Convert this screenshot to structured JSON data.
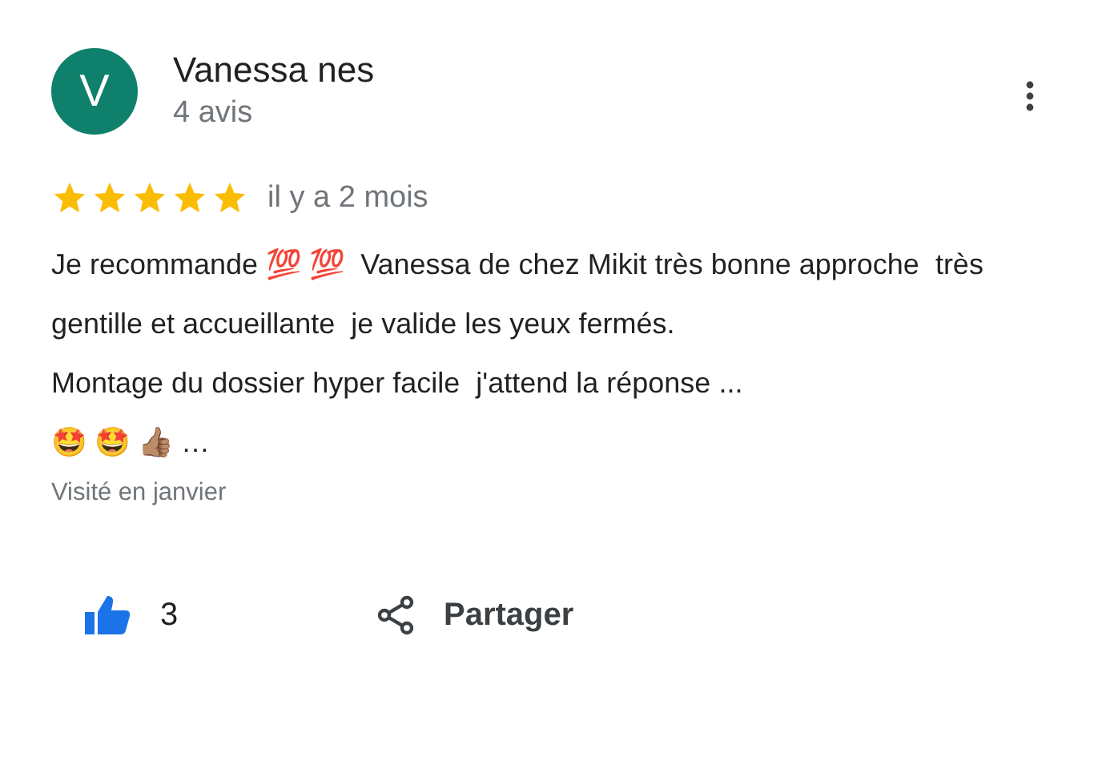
{
  "review": {
    "avatar_letter": "V",
    "author": "Vanessa nes",
    "review_count": "4 avis",
    "stars": 5,
    "time": "il y a 2 mois",
    "text": "Je recommande 💯 💯  Vanessa de chez Mikit très bonne approche  très gentille et accueillante  je valide les yeux fermés.\nMontage du dossier hyper facile  j'attend la réponse ...\n🤩 🤩 👍🏽 …",
    "visited": "Visité en janvier"
  },
  "actions": {
    "like": {
      "count": "3",
      "liked": true
    },
    "share": {
      "label": "Partager"
    }
  }
}
